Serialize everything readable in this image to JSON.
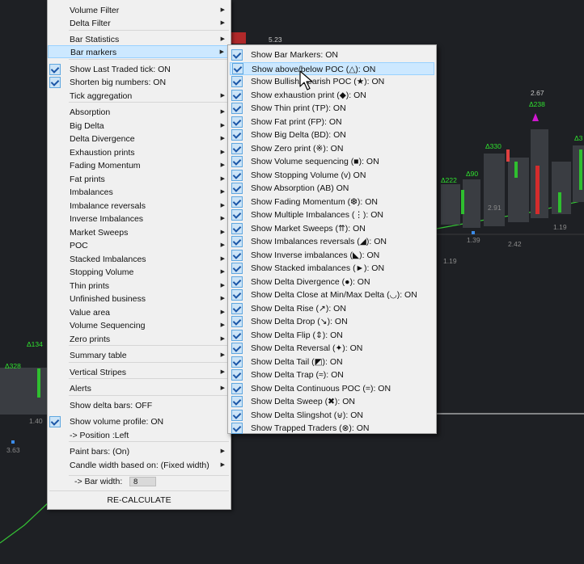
{
  "chart_bg": {
    "labels": [
      "5.23",
      "2.67",
      "Δ238",
      "Δ330",
      "Δ222",
      "Δ90",
      "Δ134",
      "Δ328",
      "2.91",
      "1.39",
      "2.42",
      "1.19",
      "1.19",
      "1.40",
      "3.63",
      "Δ3"
    ]
  },
  "main_menu": {
    "items": [
      {
        "label": "Volume Filter",
        "submenu": true,
        "checked": false
      },
      {
        "label": "Delta Filter",
        "submenu": true,
        "checked": false
      },
      {
        "label": "Bar Statistics",
        "submenu": true,
        "checked": false
      },
      {
        "label": "Bar markers",
        "submenu": true,
        "checked": false
      },
      {
        "label": "Show Last Traded tick: ON",
        "submenu": false,
        "checked": true
      },
      {
        "label": "Shorten big numbers: ON",
        "submenu": false,
        "checked": true
      },
      {
        "label": "Tick aggregation",
        "submenu": true,
        "checked": false
      },
      {
        "label": "Absorption",
        "submenu": true,
        "checked": false
      },
      {
        "label": "Big Delta",
        "submenu": true,
        "checked": false
      },
      {
        "label": "Delta Divergence",
        "submenu": true,
        "checked": false
      },
      {
        "label": "Exhaustion prints",
        "submenu": true,
        "checked": false
      },
      {
        "label": "Fading Momentum",
        "submenu": true,
        "checked": false
      },
      {
        "label": "Fat prints",
        "submenu": true,
        "checked": false
      },
      {
        "label": "Imbalances",
        "submenu": true,
        "checked": false
      },
      {
        "label": "Imbalance reversals",
        "submenu": true,
        "checked": false
      },
      {
        "label": "Inverse Imbalances",
        "submenu": true,
        "checked": false
      },
      {
        "label": "Market Sweeps",
        "submenu": true,
        "checked": false
      },
      {
        "label": "POC",
        "submenu": true,
        "checked": false
      },
      {
        "label": "Stacked Imbalances",
        "submenu": true,
        "checked": false
      },
      {
        "label": "Stopping Volume",
        "submenu": true,
        "checked": false
      },
      {
        "label": "Thin prints",
        "submenu": true,
        "checked": false
      },
      {
        "label": "Unfinished business",
        "submenu": true,
        "checked": false
      },
      {
        "label": "Value area",
        "submenu": true,
        "checked": false
      },
      {
        "label": "Volume Sequencing",
        "submenu": true,
        "checked": false
      },
      {
        "label": "Zero prints",
        "submenu": true,
        "checked": false
      },
      {
        "label": "Summary table",
        "submenu": true,
        "checked": false
      },
      {
        "label": "Vertical Stripes",
        "submenu": true,
        "checked": false
      },
      {
        "label": "Alerts",
        "submenu": true,
        "checked": false
      },
      {
        "label": "Show delta bars: OFF",
        "submenu": false,
        "checked": false
      },
      {
        "label": "Show volume profile: ON",
        "submenu": false,
        "checked": true
      },
      {
        "label": "-> Position :Left",
        "submenu": false,
        "checked": false
      },
      {
        "label": "Paint bars: (On)",
        "submenu": true,
        "checked": false
      },
      {
        "label": "Candle width based on: (Fixed width)",
        "submenu": true,
        "checked": false
      }
    ],
    "bar_width": {
      "label": "-> Bar width:",
      "value": "8"
    },
    "recalculate_label": "RE-CALCULATE"
  },
  "submenu": {
    "items": [
      "Show Bar Markers: ON",
      "Show above/below POC (△): ON",
      "Show Bullish/Bearish POC (★): ON",
      "Show exhaustion print (◆): ON",
      "Show Thin print (TP): ON",
      "Show Fat print (FP): ON",
      "Show Big Delta (BD): ON",
      "Show Zero print (※): ON",
      "Show Volume sequencing (■): ON",
      "Show Stopping Volume (v) ON",
      "Show Absorption (AB) ON",
      "Show Fading Momentum (❆): ON",
      "Show Multiple Imbalances (⋮): ON",
      "Show Market Sweeps (⇈): ON",
      "Show Imbalances reversals (◢): ON",
      "Show Inverse imbalances (◣): ON",
      "Show Stacked imbalances (►): ON",
      "Show Delta Divergence (●): ON",
      "Show Delta Close at Min/Max Delta (◡): ON",
      "Show Delta Rise (↗): ON",
      "Show Delta Drop (↘): ON",
      "Show Delta Flip (⇕): ON",
      "Show Delta Reversal (✦): ON",
      "Show Delta Tail (◩): ON",
      "Show Delta Trap (≈): ON",
      "Show Delta Continuous POC (=): ON",
      "Show Delta Sweep (✖): ON",
      "Show Delta Slingshot (⊎): ON",
      "Show Trapped Traders (⊗): ON"
    ]
  }
}
